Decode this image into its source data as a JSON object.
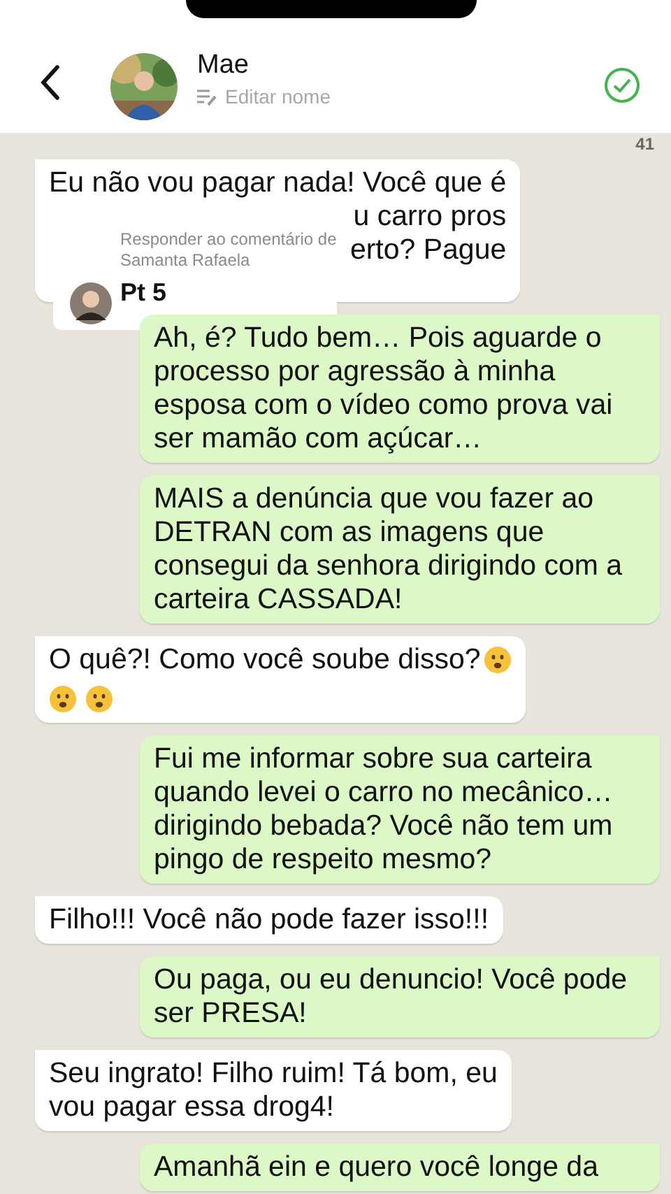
{
  "header": {
    "contact_name": "Mae",
    "subtitle": "Editar nome",
    "verified": true
  },
  "chat": {
    "count": "41",
    "messages": [
      {
        "kind": "incoming",
        "text": "Eu não vou pagar nada! Você que é",
        "tail_text": "u carro pros\nerto? Pague",
        "reply_overlay": {
          "prompt": "Responder ao comentário de Samanta Rafaela",
          "title": "Pt 5"
        }
      },
      {
        "kind": "outgoing",
        "text": "Ah, é? Tudo bem… Pois aguarde o\nprocesso por agressão à minha\nesposa com o vídeo como prova vai\nser mamão com açúcar…"
      },
      {
        "kind": "outgoing",
        "text": "MAIS a denúncia que vou fazer ao\nDETRAN com as imagens que\nconsegui da senhora dirigindo com a\ncarteira CASSADA!"
      },
      {
        "kind": "incoming",
        "text": "O quê?! Como você soube disso?",
        "with_emoji": true
      },
      {
        "kind": "outgoing",
        "text": "Fui me informar sobre sua carteira\nquando levei o carro no mecânico…\ndirigindo bebada? Você não tem um\npingo de respeito mesmo?"
      },
      {
        "kind": "incoming",
        "text": "Filho!!! Você não pode fazer isso!!!"
      },
      {
        "kind": "outgoing",
        "text": "Ou paga, ou eu denuncio! Você pode\nser PRESA!"
      },
      {
        "kind": "incoming",
        "text": "Seu ingrato! Filho ruim! Tá bom, eu\nvou pagar essa drog4!"
      },
      {
        "kind": "outgoing",
        "text": "Amanhã ein e quero você longe da"
      }
    ]
  }
}
